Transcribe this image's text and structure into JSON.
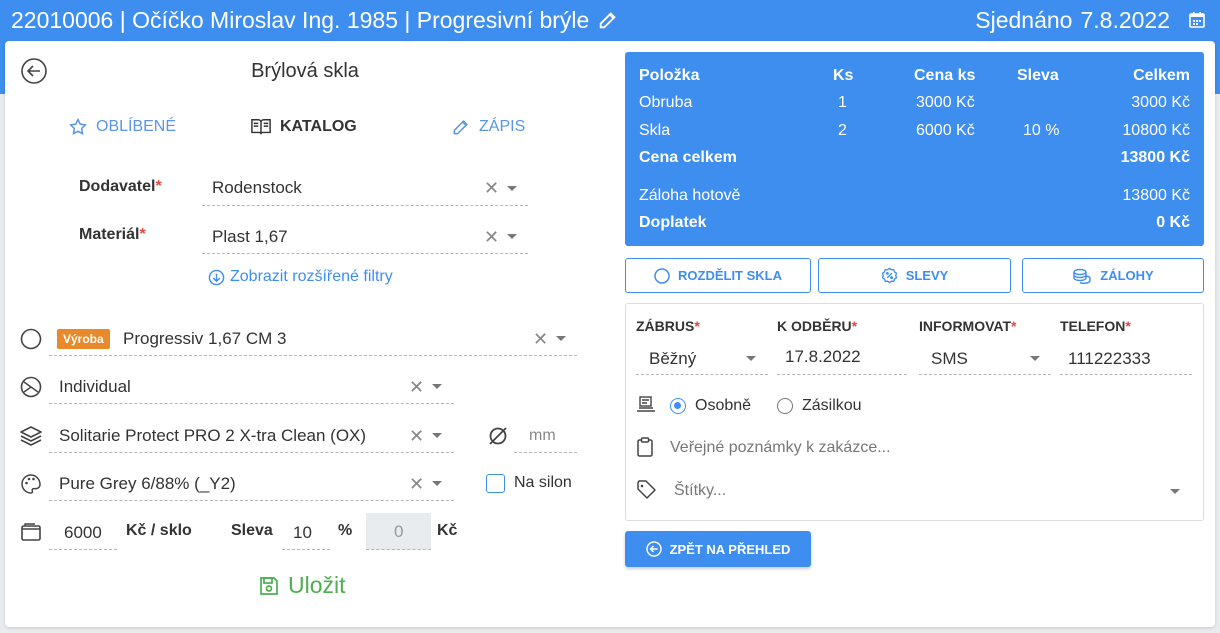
{
  "header": {
    "title": "22010006 | Očíčko Miroslav Ing. 1985 | Progresivní brýle",
    "status_label": "Sjednáno",
    "status_date": "7.8.2022",
    "edit_icon": "pencil-icon",
    "calendar_icon": "calendar-icon"
  },
  "left": {
    "title": "Brýlová skla",
    "tabs": [
      {
        "label": "OBLÍBENÉ",
        "icon": "star-icon"
      },
      {
        "label": "KATALOG",
        "icon": "book-icon"
      },
      {
        "label": "ZÁPIS",
        "icon": "pencil-icon"
      }
    ],
    "supplier_label": "Dodavatel",
    "supplier_value": "Rodenstock",
    "material_label": "Materiál",
    "material_value": "Plast 1,67",
    "filters_link": "Zobrazit rozšířené filtry",
    "lens_badge": "Výroba",
    "lens_value": "Progressiv 1,67 CM 3",
    "design_value": "Individual",
    "coating_value": "Solitarie Protect PRO 2 X-tra Clean (OX)",
    "diameter_unit": "mm",
    "tint_value": "Pure Grey 6/88% (_Y2)",
    "nylon_label": "Na silon",
    "price_value": "6000",
    "price_unit": "Kč / sklo",
    "discount_label": "Sleva",
    "discount_value": "10",
    "discount_unit": "%",
    "discount_amount": "0",
    "discount_currency": "Kč",
    "save_label": "Uložit"
  },
  "summary": {
    "headers": [
      "Položka",
      "Ks",
      "Cena ks",
      "Sleva",
      "Celkem"
    ],
    "rows": [
      [
        "Obruba",
        "1",
        "3000 Kč",
        "",
        "3000 Kč"
      ],
      [
        "Skla",
        "2",
        "6000 Kč",
        "10 %",
        "10800 Kč"
      ]
    ],
    "total_label": "Cena celkem",
    "total_value": "13800 Kč",
    "deposit_label": "Záloha hotově",
    "deposit_value": "13800 Kč",
    "remaining_label": "Doplatek",
    "remaining_value": "0 Kč"
  },
  "actions": {
    "split": "ROZDĚLIT SKLA",
    "discounts": "SLEVY",
    "deposits": "ZÁLOHY"
  },
  "order": {
    "urgency_label": "ZÁBRUS",
    "urgency_value": "Běžný",
    "pickup_label": "K ODBĚRU",
    "pickup_value": "17.8.2022",
    "notify_label": "INFORMOVAT",
    "notify_value": "SMS",
    "phone_label": "TELEFON",
    "phone_value": "111222333",
    "delivery_personal": "Osobně",
    "delivery_post": "Zásilkou",
    "notes_placeholder": "Veřejné poznámky k zakázce...",
    "tags_placeholder": "Štítky..."
  },
  "back_button": "ZPĚT NA PŘEHLED"
}
